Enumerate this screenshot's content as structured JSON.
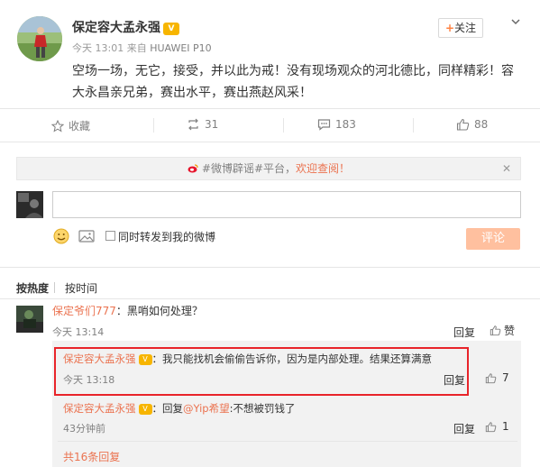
{
  "post": {
    "username": "保定容大孟永强",
    "vip_badge": "V",
    "follow_label": "关注",
    "follow_plus": "+",
    "more_icon": "chevron-down-icon",
    "time": "今天 13:01",
    "source_prefix": "来自",
    "device": "HUAWEI P10",
    "text": "空场一场，无它，接受，并以此为戒！没有现场观众的河北德比，同样精彩！容大永昌亲兄弟，赛出水平，赛出燕赵风采！"
  },
  "actions": {
    "favorite_label": "收藏",
    "repost_count": "31",
    "comment_count": "183",
    "like_count": "88"
  },
  "tip": {
    "hashtag": "#微博辟谣#平台，",
    "link": "欢迎查阅！",
    "close": "✕"
  },
  "composer": {
    "placeholder": "",
    "forward_label": "同时转发到我的微博",
    "submit_label": "评论"
  },
  "sort": {
    "hot": "按热度",
    "time": "按时间"
  },
  "comments": [
    {
      "name": "保定爷们777",
      "text": "：黑哨如何处理？",
      "time": "今天 13:14",
      "reply_label": "回复",
      "like_label": "赞"
    }
  ],
  "replies": [
    {
      "name": "保定容大孟永强",
      "text": "：我只能找机会偷偷告诉你，因为是内部处理。结果还算满意",
      "time": "今天 13:18",
      "reply_label": "回复",
      "like_count": "7"
    },
    {
      "name": "保定容大孟永强",
      "text_prefix": "：回复",
      "mention": "@Yip希望",
      "text_suffix": ":不想被罚钱了",
      "time": "43分钟前",
      "reply_label": "回复",
      "like_count": "1"
    }
  ],
  "total_replies": "共16条回复",
  "colors": {
    "accent": "#eb7350",
    "highlight": "#e8242a",
    "vip": "#f7b500",
    "button_disabled": "#ffc09f"
  }
}
